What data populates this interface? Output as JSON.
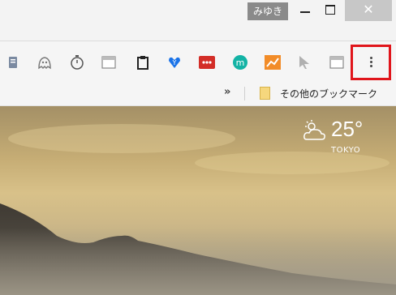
{
  "window": {
    "user_name": "みゆき",
    "close_glyph": "✕"
  },
  "toolbar": {
    "extensions": [
      {
        "name": "doc-ext-icon"
      },
      {
        "name": "ghost-ext-icon"
      },
      {
        "name": "stopwatch-icon"
      },
      {
        "name": "window-ext-icon"
      },
      {
        "name": "clipboard-icon"
      },
      {
        "name": "heart-y-icon"
      },
      {
        "name": "lastpass-icon"
      },
      {
        "name": "mendeley-m-icon"
      },
      {
        "name": "chart-icon"
      },
      {
        "name": "cursor-icon"
      },
      {
        "name": "window-ext-2-icon"
      }
    ],
    "colors": {
      "heart": "#1a73e8",
      "lastpass": "#d32d27",
      "mendeley": "#13b3a5",
      "chart": "#f28c28",
      "highlight": "#e0151b"
    }
  },
  "bookmarks": {
    "more_chevron": "»",
    "other_bookmarks": "その他のブックマーク"
  },
  "weather": {
    "temp": "25°",
    "city": "TOKYO"
  }
}
